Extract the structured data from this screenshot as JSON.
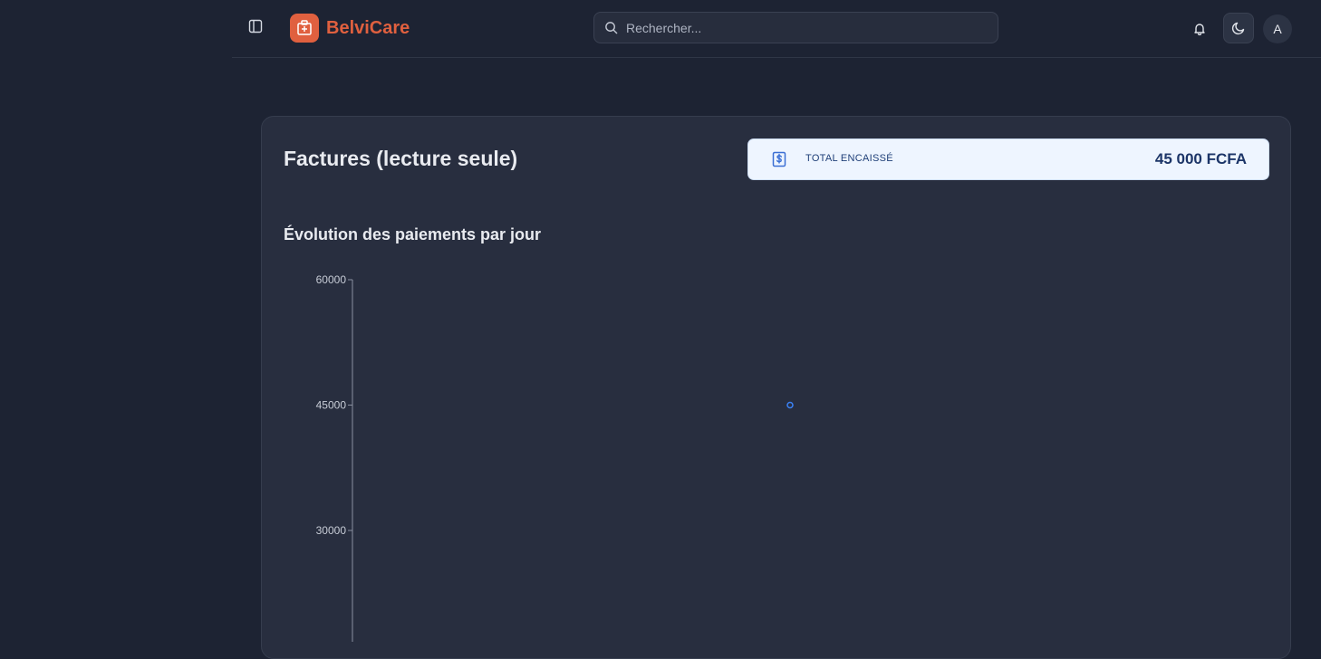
{
  "app": {
    "brand": "BelviCare"
  },
  "search": {
    "placeholder": "Rechercher..."
  },
  "user": {
    "avatar_initial": "A"
  },
  "page": {
    "title": "Factures (lecture seule)"
  },
  "stat": {
    "label": "TOTAL ENCAISSÉ",
    "value": "45 000 FCFA",
    "icon": "dollar-receipt-icon"
  },
  "chart": {
    "title": "Évolution des paiements par jour"
  },
  "colors": {
    "brand": "#e0603f",
    "background": "#1d2333",
    "card": "#282e3f",
    "point": "#3b82f6"
  },
  "chart_data": {
    "type": "line",
    "title": "Évolution des paiements par jour",
    "xlabel": "",
    "ylabel": "",
    "ylim": [
      0,
      60000
    ],
    "yticks": [
      60000,
      45000,
      30000
    ],
    "series": [
      {
        "points": [
          {
            "y": 45000
          }
        ]
      }
    ]
  }
}
